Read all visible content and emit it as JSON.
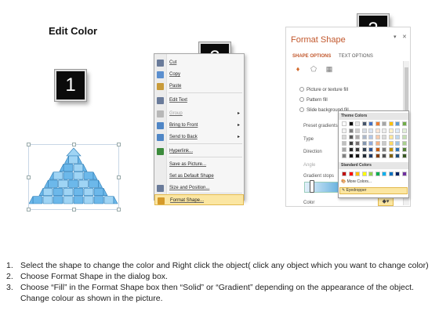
{
  "title": "Edit Color",
  "steps_badges": [
    "1",
    "2",
    "3"
  ],
  "context_menu": {
    "items": [
      {
        "label": "Cut",
        "icon": "scissors-icon",
        "enabled": true
      },
      {
        "label": "Copy",
        "icon": "copy-icon",
        "enabled": true
      },
      {
        "label": "Paste",
        "icon": "paste-icon",
        "enabled": true
      },
      {
        "label": "Edit Text",
        "icon": "edit-text-icon",
        "enabled": true
      },
      {
        "label": "Group",
        "icon": "group-icon",
        "enabled": false
      },
      {
        "label": "Bring to Front",
        "icon": "bring-front-icon",
        "enabled": true
      },
      {
        "label": "Send to Back",
        "icon": "send-back-icon",
        "enabled": true
      },
      {
        "label": "Hyperlink...",
        "icon": "hyperlink-icon",
        "enabled": true
      },
      {
        "label": "Save as Picture...",
        "icon": "",
        "enabled": true
      },
      {
        "label": "Set as Default Shape",
        "icon": "",
        "enabled": true
      },
      {
        "label": "Size and Position...",
        "icon": "size-position-icon",
        "enabled": true
      },
      {
        "label": "Format Shape...",
        "icon": "format-shape-icon",
        "enabled": true,
        "highlighted": true
      }
    ]
  },
  "format_pane": {
    "title": "Format Shape",
    "controls": [
      "▾",
      "✕"
    ],
    "tab_active": "SHAPE OPTIONS",
    "tab_other": "TEXT OPTIONS",
    "fill_options": [
      "Picture or texture fill",
      "Pattern fill",
      "Slide background fill"
    ],
    "properties": [
      "Preset gradients",
      "Type",
      "Direction",
      "Angle",
      "Gradient stops",
      "Color"
    ],
    "color_picker": {
      "theme_header": "Theme Colors",
      "standard_header": "Standard Colors",
      "more_colors": "More Colors...",
      "eyedropper": "Eyedropper",
      "theme_top": [
        "#ffffff",
        "#000000",
        "#e7e6e6",
        "#44546a",
        "#4472c4",
        "#ed7d31",
        "#a5a5a5",
        "#ffc000",
        "#5b9bd5",
        "#70ad47"
      ],
      "theme_cols": [
        [
          "#f2f2f2",
          "#d9d9d9",
          "#bfbfbf",
          "#a6a6a6",
          "#808080"
        ],
        [
          "#7f7f7f",
          "#595959",
          "#3f3f3f",
          "#262626",
          "#0d0d0d"
        ],
        [
          "#d0cece",
          "#aeabab",
          "#757070",
          "#3a3838",
          "#171616"
        ],
        [
          "#d6dce4",
          "#adb9ca",
          "#8497b0",
          "#323f4f",
          "#222a35"
        ],
        [
          "#dae3f3",
          "#b4c7e7",
          "#8faadc",
          "#2f5597",
          "#1f3864"
        ],
        [
          "#fbe5d6",
          "#f8cbad",
          "#f4b183",
          "#c55a11",
          "#843c0c"
        ],
        [
          "#ededed",
          "#dbdbdb",
          "#c9c9c9",
          "#7b7b7b",
          "#525252"
        ],
        [
          "#fff2cc",
          "#ffe699",
          "#ffd966",
          "#bf9000",
          "#7f6000"
        ],
        [
          "#deebf7",
          "#bdd7ee",
          "#9dc3e6",
          "#2e75b6",
          "#1f4e79"
        ],
        [
          "#e2f0d9",
          "#c5e0b4",
          "#a9d18e",
          "#538135",
          "#385723"
        ]
      ],
      "standard": [
        "#c00000",
        "#ff0000",
        "#ffc000",
        "#ffff00",
        "#92d050",
        "#00b050",
        "#00b0f0",
        "#0070c0",
        "#002060",
        "#7030a0"
      ]
    }
  },
  "pyramid": {
    "fill_colors": [
      "#9fd4f4",
      "#6cb8ea"
    ],
    "stroke_color": "#2f7fb8"
  },
  "instructions": [
    {
      "n": "1.",
      "text": "Select the shape to change the color and Right click the object( click any object which you want to change color)"
    },
    {
      "n": "2.",
      "text": "Choose Format Shape in the dialog box."
    },
    {
      "n": "3.",
      "text": "Choose “Fill” in the Format Shape box then “Solid” or “Gradient” depending on the appearance of the object. Change colour as shown in the picture."
    }
  ]
}
